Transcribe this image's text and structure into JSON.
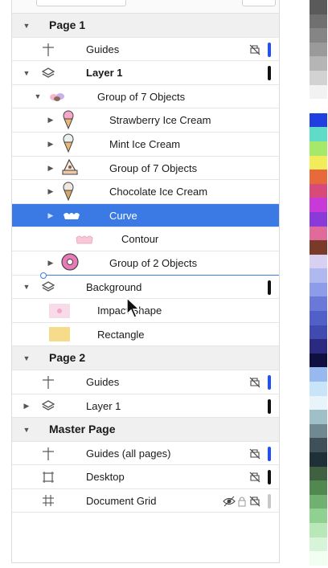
{
  "panel": {
    "rows": [
      {
        "kind": "page",
        "label": "Page 1",
        "expanded": true
      },
      {
        "kind": "guides",
        "label": "Guides",
        "indicator": "#1f4fff"
      },
      {
        "kind": "layer",
        "label": "Layer 1",
        "bold": true,
        "expanded": true,
        "indicator": "#111111"
      },
      {
        "kind": "group",
        "label": "Group of 7 Objects",
        "expanded": true
      },
      {
        "kind": "object",
        "label": "Strawberry Ice Cream",
        "thumb": "strawberry-icecream-icon"
      },
      {
        "kind": "object",
        "label": "Mint Ice Cream",
        "thumb": "mint-icecream-icon"
      },
      {
        "kind": "object",
        "label": "Group of 7 Objects",
        "thumb": "cake-slice-icon"
      },
      {
        "kind": "object",
        "label": "Chocolate Ice Cream",
        "thumb": "chocolate-icecream-icon"
      },
      {
        "kind": "curve",
        "label": "Curve",
        "selected": true
      },
      {
        "kind": "contour",
        "label": "Contour"
      },
      {
        "kind": "object",
        "label": "Group of 2 Objects",
        "thumb": "donut-icon"
      },
      {
        "kind": "layer",
        "label": "Background",
        "expanded": true,
        "indicator": "#111111"
      },
      {
        "kind": "shape",
        "label": "Impact Shape",
        "thumb": "impact-shape-icon"
      },
      {
        "kind": "shape",
        "label": "Rectangle",
        "thumb": "rectangle-icon"
      },
      {
        "kind": "page",
        "label": "Page 2",
        "expanded": true
      },
      {
        "kind": "guides",
        "label": "Guides",
        "indicator": "#1f4fff"
      },
      {
        "kind": "layer2",
        "label": "Layer 1",
        "indicator": "#111111"
      },
      {
        "kind": "page",
        "label": "Master Page",
        "expanded": true
      },
      {
        "kind": "guides",
        "label": "Guides (all pages)",
        "indicator": "#1f4fff"
      },
      {
        "kind": "desktop",
        "label": "Desktop",
        "indicator": "#111111"
      },
      {
        "kind": "grid",
        "label": "Document Grid",
        "indicator": "#c8c8c8"
      }
    ]
  },
  "palette": [
    "#5a5a5a",
    "#707070",
    "#858585",
    "#9a9a9a",
    "#b5b5b5",
    "#d2d2d2",
    "#f2f2f2",
    "#ffffff",
    "#1f3fe0",
    "#5fdcc8",
    "#a6e86a",
    "#f2ec5a",
    "#e86a3a",
    "#d84a7a",
    "#c83ad8",
    "#8a3ad8",
    "#e06a9a",
    "#7a3a2a",
    "#d8d0f0",
    "#b0b8f0",
    "#8c9ce8",
    "#6a78d8",
    "#5060c8",
    "#404ab0",
    "#2a2a80",
    "#101040",
    "#98b8f0",
    "#c8e4f8",
    "#e8f4fa",
    "#a0c0c8",
    "#708890",
    "#405058",
    "#203038",
    "#406040",
    "#508850",
    "#70b070",
    "#90d090",
    "#b8e8b8",
    "#d8f4d8",
    "#f0fff0"
  ]
}
